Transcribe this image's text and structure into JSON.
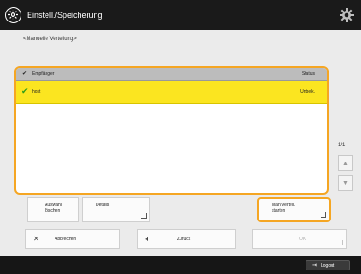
{
  "header": {
    "title": "Einstell./Speicherung",
    "app_icon": "gear-circle-icon",
    "settings_icon": "gear-icon"
  },
  "page": {
    "subtitle": "<Manuelle Verteilung>"
  },
  "list": {
    "columns": {
      "recipient": "Empfänger",
      "status": "Status"
    },
    "rows": [
      {
        "name": "host",
        "status": "Unbek.",
        "checked": true,
        "selected": true
      }
    ],
    "page_counter": "1/1"
  },
  "buttons": {
    "clear_selection": [
      "Auswahl",
      "löschen"
    ],
    "details": "Details",
    "start_distribution": [
      "Man.Verteil.",
      "starten"
    ],
    "cancel": "Abbrechen",
    "back": "Zurück",
    "ok": "OK",
    "logout": "Logout"
  },
  "colors": {
    "accent": "#f5a623",
    "selected_row": "#fbe520",
    "check": "#2e9d1a",
    "bar": "#1a1a1a"
  }
}
